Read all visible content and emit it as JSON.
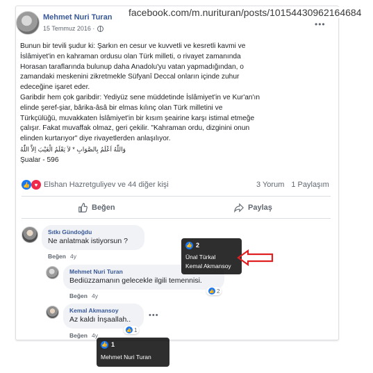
{
  "url_bar": "facebook.com/m.nurituran/posts/10154430962164684",
  "post": {
    "author": "Mehmet Nuri Turan",
    "date": "15 Temmuz 2016 ·",
    "lines": [
      "Bunun bir tevili şudur ki: Şarkın en cesur ve kuvvetli ve kesretli kavmi ve",
      "İslâmiyet'in en kahraman ordusu olan Türk milleti, o rivayet zamanında",
      "Horasan taraflarında bulunup daha Anadolu'yu vatan yapmadığından, o",
      "zamandaki meskenini zikretmekle Süfyanî Deccal onların içinde zuhur",
      "edeceğine işaret eder.",
      "Garibdir hem çok garibdir: Yediyüz sene müddetinde İslâmiyet'in ve Kur'an'ın",
      "elinde şeref-şiar, bârika-âsâ bir elmas kılınç olan Türk milletini ve",
      "Türkçülüğü, muvakkaten İslâmiyet'in bir kısım şeairine karşı istimal etmeğe",
      "çalışır. Fakat muvaffak olmaz, geri çekilir. \"Kahraman ordu, dizginini onun",
      "elinden kurtarıyor\" diye rivayetlerden anlaşılıyor."
    ],
    "arabic": "وَاللّٰهُ اَعْلَمُ بِالصَّوَابِ * لاَ يَعْلَمُ الْغَيْبَ اِلاَّ اللّٰهُ",
    "source": "Şualar - 596",
    "reactions_text": "Elshan Hazretguliyev ve 44 diğer kişi",
    "comments_count": "3 Yorum",
    "shares_count": "1 Paylaşım",
    "like_label": "Beğen",
    "share_label": "Paylaş",
    "more": "•••"
  },
  "comments": [
    {
      "name": "Sıtkı Gündoğdu",
      "text": "Ne anlatmak istiyorsun ?",
      "like": "Beğen",
      "time": "4y"
    },
    {
      "name": "Mehmet Nuri Turan",
      "text": "Bediüzzamanın gelecekle ilgili temennisi.",
      "like": "Beğen",
      "time": "4y",
      "reacts": "2"
    },
    {
      "name": "Kemal Akmansoy",
      "text": "Az kaldı İnşaallah..",
      "like": "Beğen",
      "time": "4y",
      "reacts": "1",
      "more": "•••"
    }
  ],
  "tooltip1": {
    "count": "2",
    "names": [
      "Ünal Türkal",
      "Kemal Akmansoy"
    ]
  },
  "tooltip2": {
    "count": "1",
    "names": [
      "Mehmet Nuri Turan"
    ]
  },
  "colors": {
    "link": "#385898",
    "like_blue": "#1877f2",
    "love_red": "#f02849",
    "arrow_red": "#e02020"
  }
}
